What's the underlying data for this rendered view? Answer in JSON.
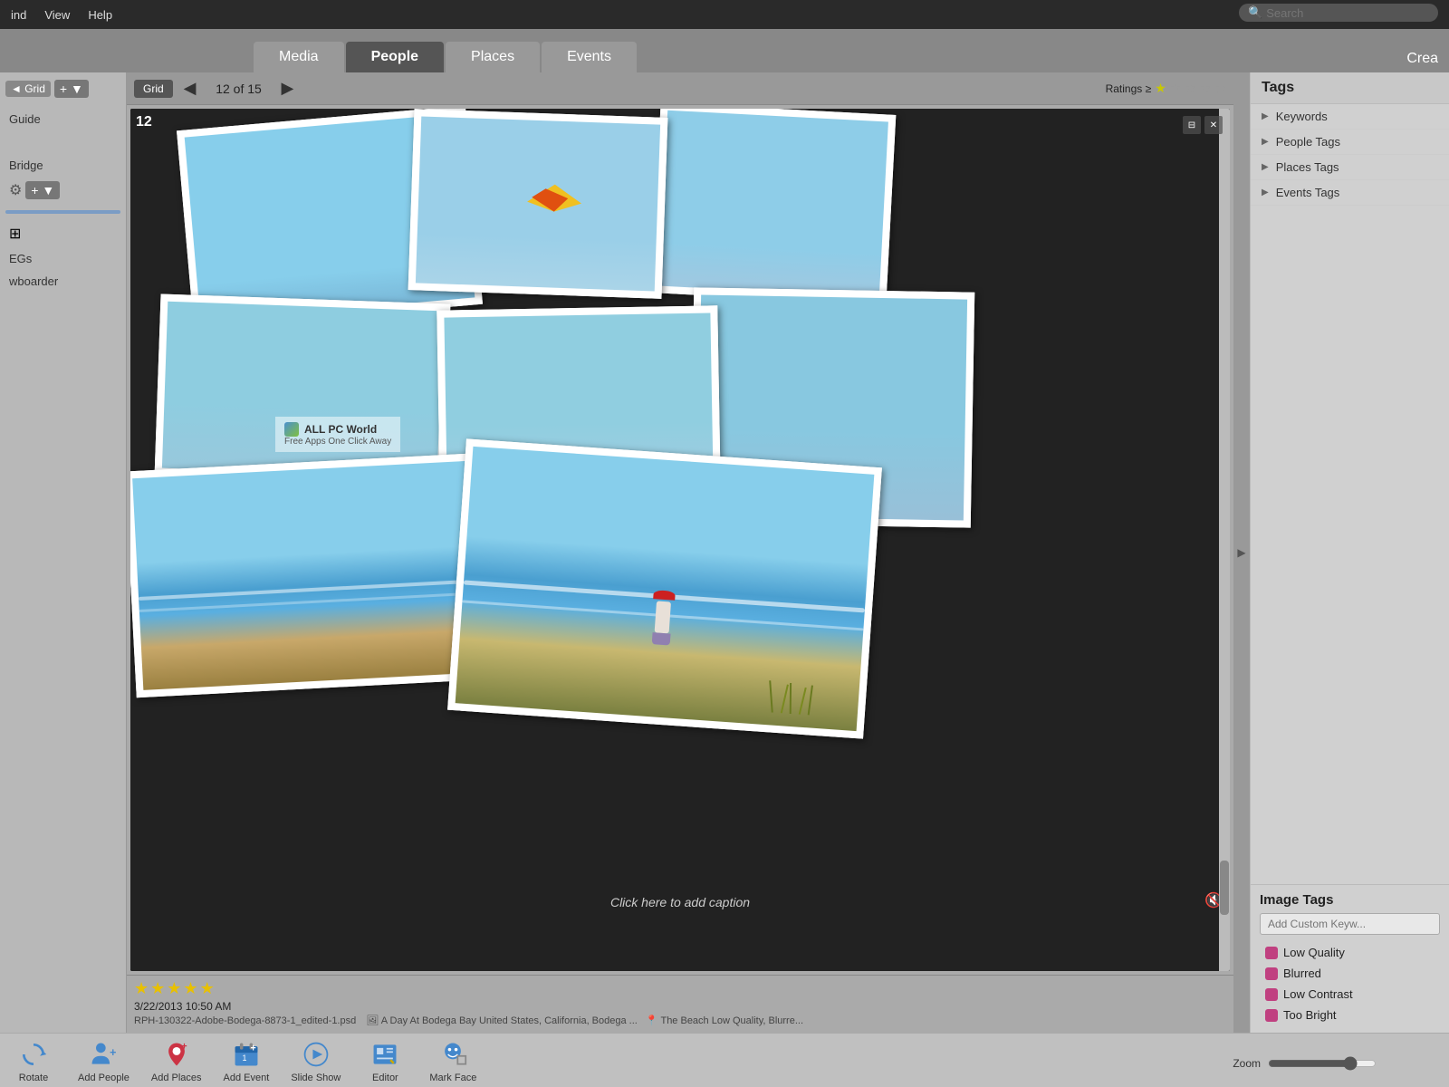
{
  "menu": {
    "items": [
      "ind",
      "View",
      "Help"
    ],
    "search_placeholder": "Search"
  },
  "tabs": [
    {
      "label": "Media",
      "active": false
    },
    {
      "label": "People",
      "active": true
    },
    {
      "label": "Places",
      "active": false
    },
    {
      "label": "Events",
      "active": false
    }
  ],
  "create_label": "Crea",
  "toolbar": {
    "grid_label": "Grid",
    "page_info": "12 of 15",
    "ratings_label": "Ratings ≥",
    "stars": [
      true,
      false,
      false,
      false,
      false
    ]
  },
  "image": {
    "number": "12",
    "caption": "Click here to add caption",
    "rating_stars": 5,
    "date": "3/22/2013 10:50 AM",
    "filename": "RPH-130322-Adobe-Bodega-8873-1_edited-1.psd",
    "location": "A Day At Bodega Bay    United States, California, Bodega ...",
    "tags_info": "The Beach    Low Quality, Blurre...",
    "watermark_title": "ALL PC World",
    "watermark_sub": "Free Apps One Click Away"
  },
  "tags": {
    "header": "Tags",
    "items": [
      {
        "label": "Keywords"
      },
      {
        "label": "People Tags"
      },
      {
        "label": "Places Tags"
      },
      {
        "label": "Events Tags"
      }
    ]
  },
  "image_tags": {
    "header": "Image Tags",
    "placeholder": "Add Custom Keyw...",
    "items": [
      {
        "label": "Low Quality",
        "color": "#c04080"
      },
      {
        "label": "Blurred",
        "color": "#c04080"
      },
      {
        "label": "Low Contrast",
        "color": "#c04080"
      },
      {
        "label": "Too Bright",
        "color": "#c04080"
      }
    ]
  },
  "bottom_toolbar": {
    "buttons": [
      {
        "label": "Rotate",
        "icon": "rotate"
      },
      {
        "label": "Add People",
        "icon": "add-people"
      },
      {
        "label": "Add Places",
        "icon": "add-places"
      },
      {
        "label": "Add Event",
        "icon": "add-event"
      },
      {
        "label": "Slide Show",
        "icon": "slideshow"
      },
      {
        "label": "Editor",
        "icon": "editor"
      },
      {
        "label": "Mark Face",
        "icon": "mark-face"
      }
    ],
    "zoom_label": "Zoom"
  },
  "left_panel": {
    "items": [
      "Guide",
      "Bridge",
      "EGs",
      "wboarder"
    ]
  }
}
